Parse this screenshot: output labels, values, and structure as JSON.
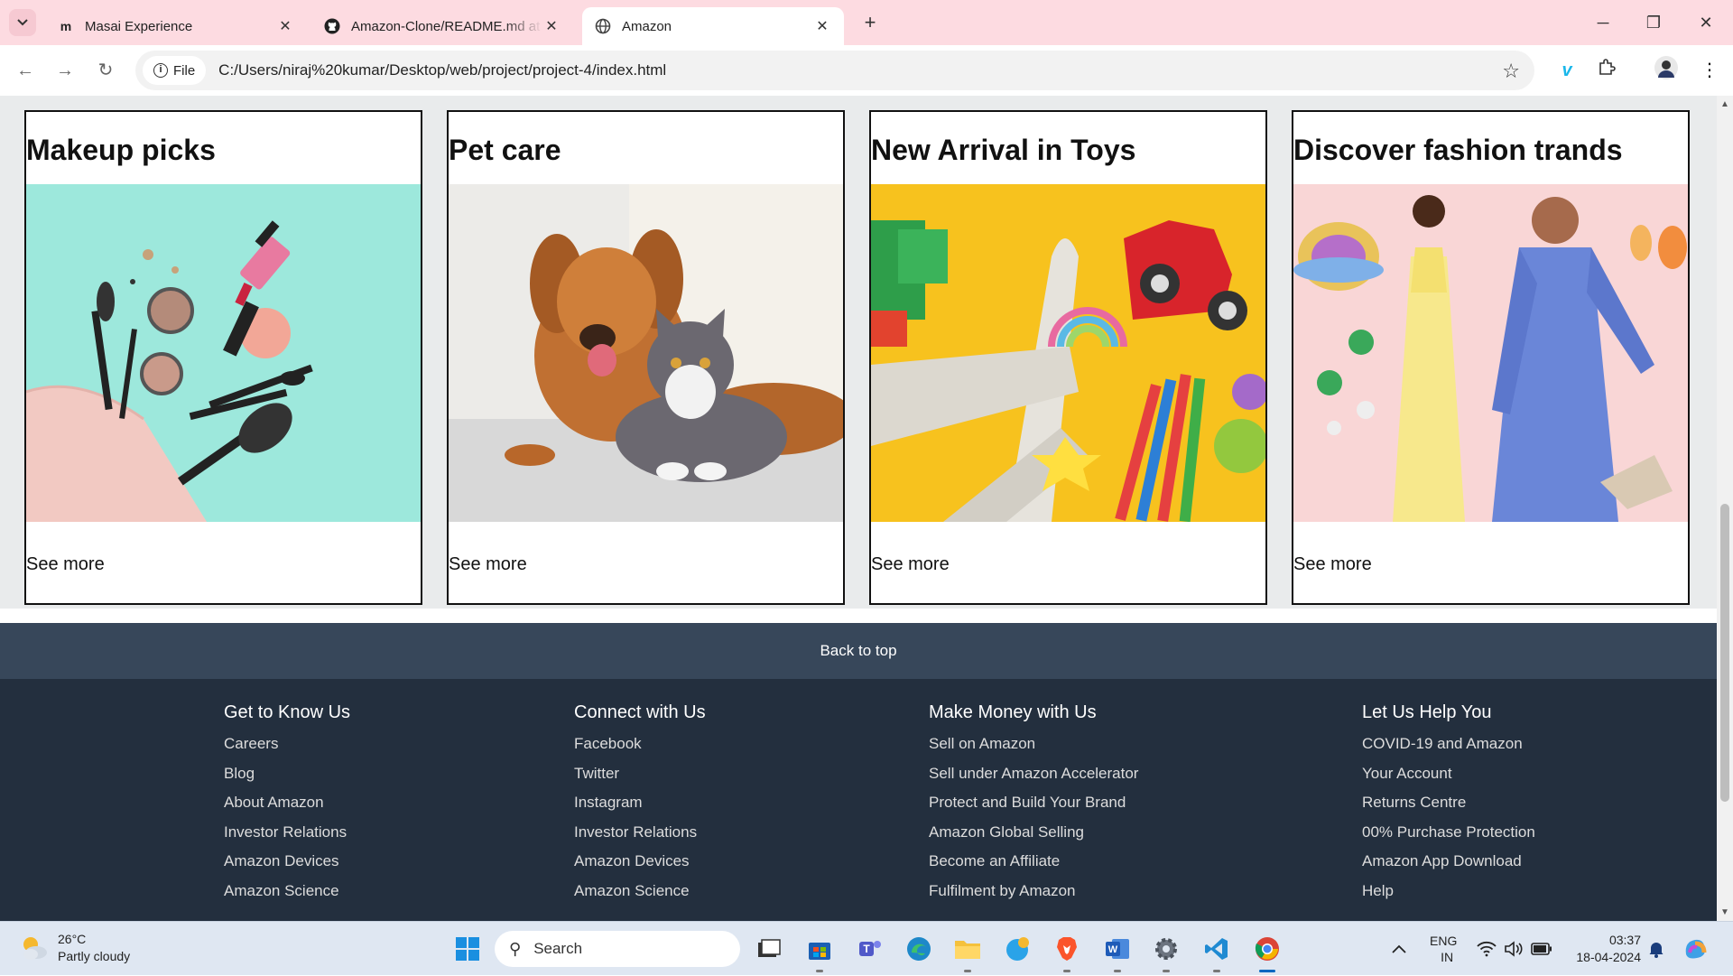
{
  "browser": {
    "tabs": [
      {
        "title": "Masai Experience",
        "icon": "masai-favicon"
      },
      {
        "title": "Amazon-Clone/README.md at",
        "icon": "github-icon"
      },
      {
        "title": "Amazon",
        "icon": "globe-icon",
        "active": true
      }
    ],
    "site_info": "File",
    "url": "C:/Users/niraj%20kumar/Desktop/web/project/project-4/index.html"
  },
  "cards": [
    {
      "title": "Makeup picks",
      "link": "See more",
      "image": "makeup-image"
    },
    {
      "title": "Pet care",
      "link": "See more",
      "image": "dog-and-cat-image"
    },
    {
      "title": "New Arrival in Toys",
      "link": "See more",
      "image": "toys-image"
    },
    {
      "title": "Discover fashion trands",
      "link": "See more",
      "image": "fashion-image"
    }
  ],
  "back_to_top": "Back to top",
  "footer": {
    "columns": [
      {
        "heading": "Get to Know Us",
        "links": [
          "Careers",
          "Blog",
          "About Amazon",
          "Investor Relations",
          "Amazon Devices",
          "Amazon Science"
        ]
      },
      {
        "heading": "Connect with Us",
        "links": [
          "Facebook",
          "Twitter",
          "Instagram",
          "Investor Relations",
          "Amazon Devices",
          "Amazon Science"
        ]
      },
      {
        "heading": "Make Money with Us",
        "links": [
          "Sell on Amazon",
          "Sell under Amazon Accelerator",
          "Protect and Build Your Brand",
          "Amazon Global Selling",
          "Become an Affiliate",
          "Fulfilment by Amazon"
        ]
      },
      {
        "heading": "Let Us Help You",
        "links": [
          "COVID-19 and Amazon",
          "Your Account",
          "Returns Centre",
          "00% Purchase Protection",
          "Amazon App Download",
          "Help"
        ]
      }
    ]
  },
  "taskbar": {
    "weather_temp": "26°C",
    "weather_desc": "Partly cloudy",
    "search_placeholder": "Search",
    "lang_line1": "ENG",
    "lang_line2": "IN",
    "time": "03:37",
    "date": "18-04-2024"
  },
  "colors": {
    "tabbar": "#fddbe1",
    "page_bg": "#e9ebec",
    "back_to_top": "#37475a",
    "footer": "#232f3e"
  }
}
